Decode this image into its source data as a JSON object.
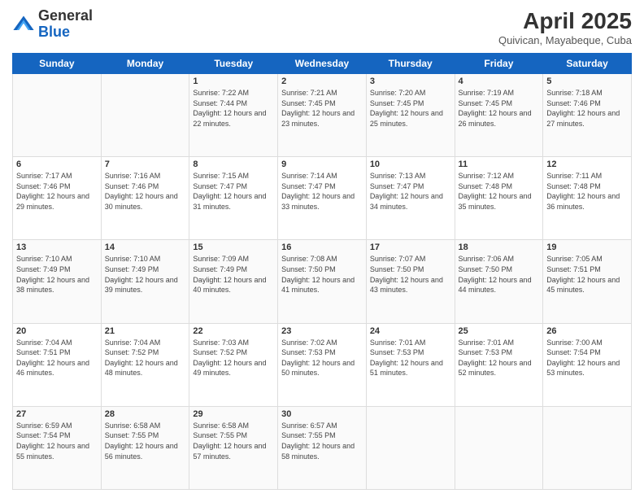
{
  "header": {
    "logo_general": "General",
    "logo_blue": "Blue",
    "title": "April 2025",
    "location": "Quivican, Mayabeque, Cuba"
  },
  "days_of_week": [
    "Sunday",
    "Monday",
    "Tuesday",
    "Wednesday",
    "Thursday",
    "Friday",
    "Saturday"
  ],
  "weeks": [
    [
      {
        "day": "",
        "info": ""
      },
      {
        "day": "",
        "info": ""
      },
      {
        "day": "1",
        "info": "Sunrise: 7:22 AM\nSunset: 7:44 PM\nDaylight: 12 hours\nand 22 minutes."
      },
      {
        "day": "2",
        "info": "Sunrise: 7:21 AM\nSunset: 7:45 PM\nDaylight: 12 hours\nand 23 minutes."
      },
      {
        "day": "3",
        "info": "Sunrise: 7:20 AM\nSunset: 7:45 PM\nDaylight: 12 hours\nand 25 minutes."
      },
      {
        "day": "4",
        "info": "Sunrise: 7:19 AM\nSunset: 7:45 PM\nDaylight: 12 hours\nand 26 minutes."
      },
      {
        "day": "5",
        "info": "Sunrise: 7:18 AM\nSunset: 7:46 PM\nDaylight: 12 hours\nand 27 minutes."
      }
    ],
    [
      {
        "day": "6",
        "info": "Sunrise: 7:17 AM\nSunset: 7:46 PM\nDaylight: 12 hours\nand 29 minutes."
      },
      {
        "day": "7",
        "info": "Sunrise: 7:16 AM\nSunset: 7:46 PM\nDaylight: 12 hours\nand 30 minutes."
      },
      {
        "day": "8",
        "info": "Sunrise: 7:15 AM\nSunset: 7:47 PM\nDaylight: 12 hours\nand 31 minutes."
      },
      {
        "day": "9",
        "info": "Sunrise: 7:14 AM\nSunset: 7:47 PM\nDaylight: 12 hours\nand 33 minutes."
      },
      {
        "day": "10",
        "info": "Sunrise: 7:13 AM\nSunset: 7:47 PM\nDaylight: 12 hours\nand 34 minutes."
      },
      {
        "day": "11",
        "info": "Sunrise: 7:12 AM\nSunset: 7:48 PM\nDaylight: 12 hours\nand 35 minutes."
      },
      {
        "day": "12",
        "info": "Sunrise: 7:11 AM\nSunset: 7:48 PM\nDaylight: 12 hours\nand 36 minutes."
      }
    ],
    [
      {
        "day": "13",
        "info": "Sunrise: 7:10 AM\nSunset: 7:49 PM\nDaylight: 12 hours\nand 38 minutes."
      },
      {
        "day": "14",
        "info": "Sunrise: 7:10 AM\nSunset: 7:49 PM\nDaylight: 12 hours\nand 39 minutes."
      },
      {
        "day": "15",
        "info": "Sunrise: 7:09 AM\nSunset: 7:49 PM\nDaylight: 12 hours\nand 40 minutes."
      },
      {
        "day": "16",
        "info": "Sunrise: 7:08 AM\nSunset: 7:50 PM\nDaylight: 12 hours\nand 41 minutes."
      },
      {
        "day": "17",
        "info": "Sunrise: 7:07 AM\nSunset: 7:50 PM\nDaylight: 12 hours\nand 43 minutes."
      },
      {
        "day": "18",
        "info": "Sunrise: 7:06 AM\nSunset: 7:50 PM\nDaylight: 12 hours\nand 44 minutes."
      },
      {
        "day": "19",
        "info": "Sunrise: 7:05 AM\nSunset: 7:51 PM\nDaylight: 12 hours\nand 45 minutes."
      }
    ],
    [
      {
        "day": "20",
        "info": "Sunrise: 7:04 AM\nSunset: 7:51 PM\nDaylight: 12 hours\nand 46 minutes."
      },
      {
        "day": "21",
        "info": "Sunrise: 7:04 AM\nSunset: 7:52 PM\nDaylight: 12 hours\nand 48 minutes."
      },
      {
        "day": "22",
        "info": "Sunrise: 7:03 AM\nSunset: 7:52 PM\nDaylight: 12 hours\nand 49 minutes."
      },
      {
        "day": "23",
        "info": "Sunrise: 7:02 AM\nSunset: 7:53 PM\nDaylight: 12 hours\nand 50 minutes."
      },
      {
        "day": "24",
        "info": "Sunrise: 7:01 AM\nSunset: 7:53 PM\nDaylight: 12 hours\nand 51 minutes."
      },
      {
        "day": "25",
        "info": "Sunrise: 7:01 AM\nSunset: 7:53 PM\nDaylight: 12 hours\nand 52 minutes."
      },
      {
        "day": "26",
        "info": "Sunrise: 7:00 AM\nSunset: 7:54 PM\nDaylight: 12 hours\nand 53 minutes."
      }
    ],
    [
      {
        "day": "27",
        "info": "Sunrise: 6:59 AM\nSunset: 7:54 PM\nDaylight: 12 hours\nand 55 minutes."
      },
      {
        "day": "28",
        "info": "Sunrise: 6:58 AM\nSunset: 7:55 PM\nDaylight: 12 hours\nand 56 minutes."
      },
      {
        "day": "29",
        "info": "Sunrise: 6:58 AM\nSunset: 7:55 PM\nDaylight: 12 hours\nand 57 minutes."
      },
      {
        "day": "30",
        "info": "Sunrise: 6:57 AM\nSunset: 7:55 PM\nDaylight: 12 hours\nand 58 minutes."
      },
      {
        "day": "",
        "info": ""
      },
      {
        "day": "",
        "info": ""
      },
      {
        "day": "",
        "info": ""
      }
    ]
  ]
}
